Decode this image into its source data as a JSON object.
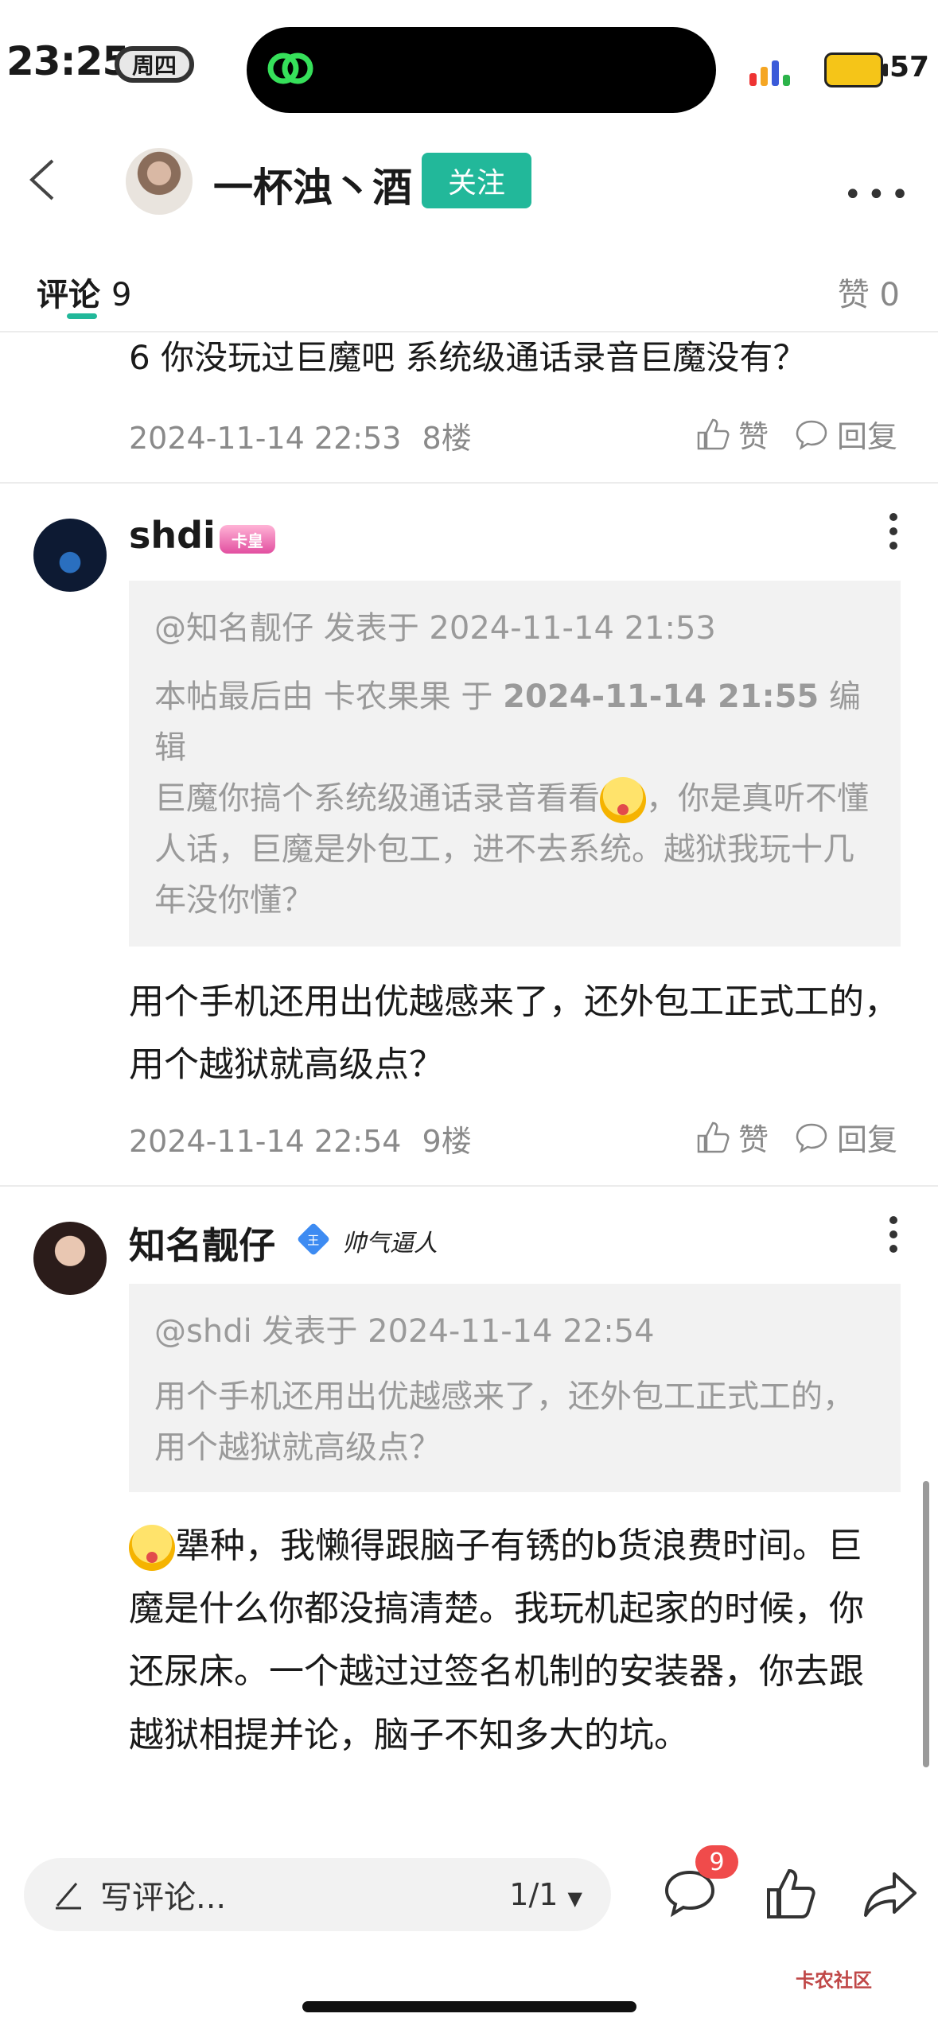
{
  "status_bar": {
    "time": "23:25",
    "weekday": "周四",
    "battery": "57"
  },
  "header": {
    "author": "一杯浊丶酒",
    "follow_label": "关注"
  },
  "tabs": {
    "comments_label": "评论",
    "comments_count": "9",
    "likes_label": "赞",
    "likes_count": "0"
  },
  "comments": [
    {
      "text": "6 你没玩过巨魔吧 系统级通话录音巨魔没有？",
      "date": "2024-11-14 22:53",
      "floor": "8楼",
      "like_label": "赞",
      "reply_label": "回复"
    },
    {
      "username": "shdi",
      "badge": "卡皇",
      "quote_header": "@知名靓仔 发表于 2024-11-14 21:53",
      "quote_edit_prefix": "本帖最后由 卡农果果 于",
      "quote_edit_date": "2024-11-14 21:55",
      "quote_edit_suffix": "编辑",
      "quote_body_a": "巨魔你搞个系统级通话录音看看",
      "quote_body_b": "，你是真听不懂人话，巨魔是外包工，进不去系统。越狱我玩十几年没你懂？",
      "text": "用个手机还用出优越感来了，还外包工正式工的，用个越狱就高级点？",
      "date": "2024-11-14 22:54",
      "floor": "9楼",
      "like_label": "赞",
      "reply_label": "回复"
    },
    {
      "username": "知名靓仔",
      "badge_level": "王",
      "title_badge": "帅气逼人",
      "quote_header": "@shdi 发表于 2024-11-14 22:54",
      "quote_body": "用个手机还用出优越感来了，还外包工正式工的，用个越狱就高级点？",
      "text": "犟种，我懒得跟脑子有锈的b货浪费时间。巨魔是什么你都没搞清楚。我玩机起家的时候，你还尿床。一个越过过签名机制的安装器，你去跟越狱相提并论，脑子不知多大的坑。"
    }
  ],
  "bottom_bar": {
    "input_placeholder": "写评论...",
    "page_indicator": "1/1",
    "comment_badge": "9"
  },
  "watermark": "卡农社区",
  "colors": {
    "accent": "#22b89a",
    "badge_red": "#f04b4b"
  }
}
